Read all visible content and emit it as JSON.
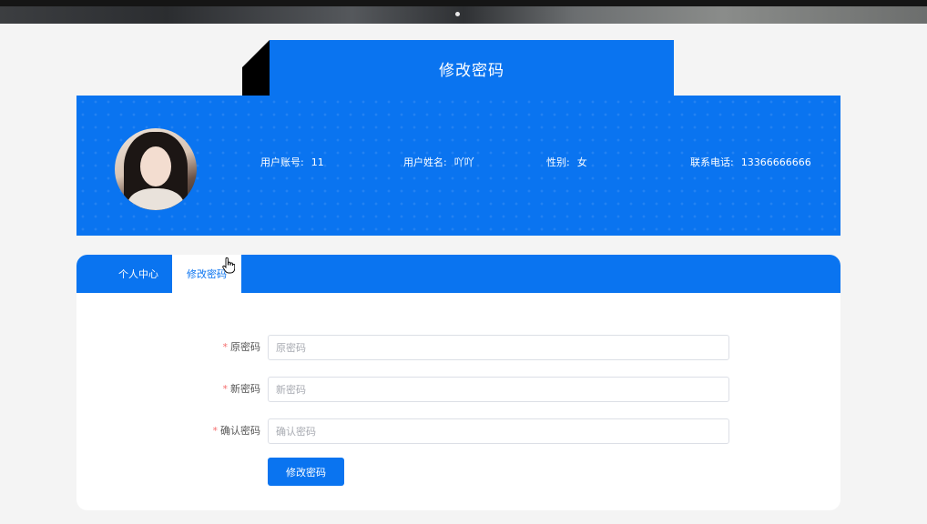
{
  "page": {
    "title": "修改密码"
  },
  "profile": {
    "account_label": "用户账号:",
    "account_value": "11",
    "name_label": "用户姓名:",
    "name_value": "吖吖",
    "gender_label": "性别:",
    "gender_value": "女",
    "phone_label": "联系电话:",
    "phone_value": "13366666666"
  },
  "tabs": [
    {
      "label": "个人中心",
      "active": false
    },
    {
      "label": "修改密码",
      "active": true
    }
  ],
  "form": {
    "required_mark": "*",
    "fields": [
      {
        "label": "原密码",
        "placeholder": "原密码",
        "value": ""
      },
      {
        "label": "新密码",
        "placeholder": "新密码",
        "value": ""
      },
      {
        "label": "确认密码",
        "placeholder": "确认密码",
        "value": ""
      }
    ],
    "submit_label": "修改密码"
  },
  "colors": {
    "primary": "#0a74f0",
    "background": "#f4f4f4",
    "required": "#f56c6c"
  },
  "icons": {
    "cursor": "hand-pointer-icon",
    "carousel_indicator": "carousel-dot-icon"
  }
}
